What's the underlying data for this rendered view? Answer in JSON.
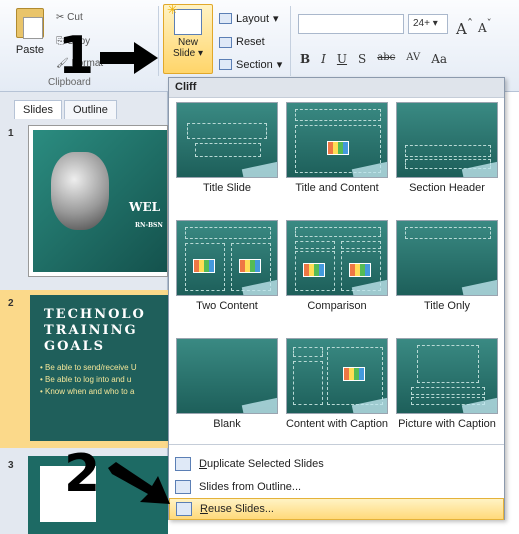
{
  "ribbon": {
    "paste_label": "Paste",
    "cut_label": "Cut",
    "copy_label": "Copy",
    "format_painter_label": "Format",
    "clipboard_group": "Clipboard",
    "new_slide_label_1": "New",
    "new_slide_label_2": "Slide",
    "layout_label": "Layout",
    "reset_label": "Reset",
    "section_label": "Section",
    "font_size": "24+",
    "bold": "B",
    "italic": "I",
    "underline": "U",
    "shadow": "S",
    "strike": "abc",
    "spacing": "AV",
    "change_case": "Aa",
    "grow_font": "A",
    "shrink_font": "A"
  },
  "annotations": {
    "step1": "1",
    "step2": "2"
  },
  "panel": {
    "tab_slides": "Slides",
    "tab_outline": "Outline",
    "slide_numbers": [
      "1",
      "2",
      "3"
    ],
    "slide1_text": "WEL",
    "slide1_sub": "RN-BSN",
    "slide2_title": [
      "TECHNOLO",
      "TRAINING",
      "GOALS"
    ],
    "slide2_bullets": [
      "• Be able to send/receive U",
      "• Be able to log into and u",
      "• Know when and who to a"
    ]
  },
  "dropdown": {
    "theme_name": "Cliff",
    "layouts": [
      {
        "label": "Title Slide"
      },
      {
        "label": "Title and Content"
      },
      {
        "label": "Section Header"
      },
      {
        "label": "Two Content"
      },
      {
        "label": "Comparison"
      },
      {
        "label": "Title Only"
      },
      {
        "label": "Blank"
      },
      {
        "label": "Content with Caption"
      },
      {
        "label": "Picture with Caption"
      }
    ],
    "menu": [
      {
        "label": "Duplicate Selected Slides"
      },
      {
        "label": "Slides from Outline..."
      },
      {
        "label": "Reuse Slides..."
      }
    ]
  }
}
